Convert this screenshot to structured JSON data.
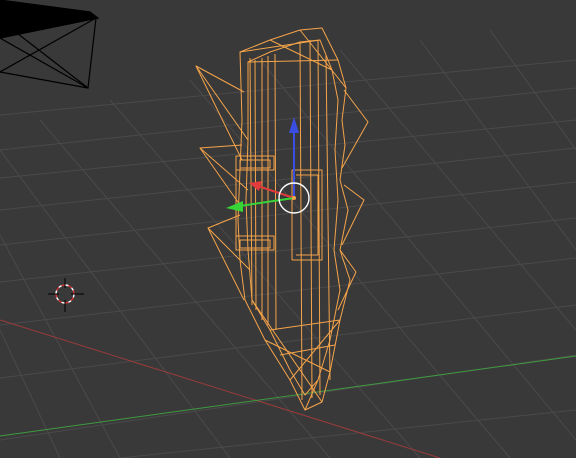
{
  "viewport": {
    "background": "#393939",
    "grid_color": "#4a4a4a",
    "x_axis_color": "#9a3b3b",
    "y_axis_color": "#3f9a3f",
    "selection_color": "#f5a44a",
    "camera_color": "#000000"
  },
  "manipulator": {
    "x_color": "#e23b3b",
    "y_color": "#36d436",
    "z_color": "#3b4ee2",
    "pivot_color": "#ffffff"
  },
  "icons": {
    "cursor": "3d-cursor-icon",
    "camera": "camera-wireframe-icon",
    "gizmo": "transform-gizmo-icon"
  }
}
